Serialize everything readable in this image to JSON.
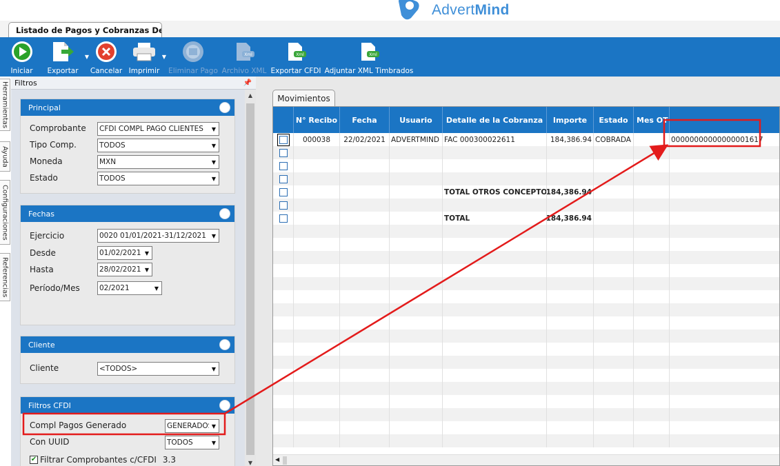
{
  "logo": {
    "text_light": "Advert",
    "text_bold": "Mind",
    "color": "#3f8fd8"
  },
  "document_tab": {
    "title": "Listado de Pagos y Cobranzas Det..."
  },
  "toolbar": {
    "buttons": [
      {
        "label": "Iniciar",
        "icon": "play-icon",
        "enabled": true
      },
      {
        "label": "Exportar",
        "icon": "export-icon",
        "enabled": true,
        "dropdown": true
      },
      {
        "label": "Cancelar",
        "icon": "cancel-icon",
        "enabled": true
      },
      {
        "label": "Imprimir",
        "icon": "printer-icon",
        "enabled": true,
        "dropdown": true
      },
      {
        "label": "Eliminar Pago",
        "icon": "delete-payment-icon",
        "enabled": false
      },
      {
        "label": "Archivo XML",
        "icon": "xml-file-icon",
        "enabled": false
      },
      {
        "label": "Exportar CFDI",
        "icon": "export-cfdi-icon",
        "enabled": true
      },
      {
        "label": "Adjuntar XML Timbrados",
        "icon": "attach-xml-icon",
        "enabled": true
      }
    ],
    "color": "#1b75c4"
  },
  "side_tabs": [
    "Herramientas",
    "Ayuda",
    "Configuraciones",
    "Referencias"
  ],
  "filtros": {
    "title": "Filtros",
    "principal": {
      "title": "Principal",
      "fields": [
        {
          "label": "Comprobante",
          "value": "CFDI COMPL PAGO CLIENTES"
        },
        {
          "label": "Tipo Comp.",
          "value": "TODOS"
        },
        {
          "label": "Moneda",
          "value": "MXN"
        },
        {
          "label": "Estado",
          "value": "TODOS"
        }
      ]
    },
    "fechas": {
      "title": "Fechas",
      "fields": [
        {
          "label": "Ejercicio",
          "value": "0020 01/01/2021-31/12/2021"
        },
        {
          "label": "Desde",
          "value": "01/02/2021"
        },
        {
          "label": "Hasta",
          "value": "28/02/2021"
        },
        {
          "label": "Período/Mes",
          "value": "02/2021"
        }
      ]
    },
    "cliente": {
      "title": "Cliente",
      "fields": [
        {
          "label": "Cliente",
          "value": "<TODOS>"
        }
      ]
    },
    "cfdi": {
      "title": "Filtros CFDI",
      "fields": [
        {
          "label": "Compl Pagos Generado",
          "value": "GENERADOS"
        },
        {
          "label": "Con UUID",
          "value": "TODOS"
        }
      ],
      "checkbox": {
        "label": "Filtrar Comprobantes c/CFDI",
        "version": "3.3",
        "checked": true
      }
    }
  },
  "movimientos": {
    "tab_label": "Movimientos",
    "columns": [
      "",
      "N° Recibo",
      "Fecha",
      "Usuario",
      "Detalle de la Cobranza",
      "Importe",
      "Estado",
      "Mes OT",
      ""
    ],
    "rows": [
      {
        "recibo": "000038",
        "fecha": "22/02/2021",
        "usuario": "ADVERTMIND",
        "detalle": "FAC 000300022611",
        "importe": "184,386.94",
        "estado": "COBRADA",
        "mes": "",
        "extra": "00000000000000001617",
        "focused": true
      },
      {
        "recibo": "",
        "fecha": "",
        "usuario": "",
        "detalle": "",
        "importe": "",
        "estado": "",
        "mes": "",
        "extra": ""
      },
      {
        "recibo": "",
        "fecha": "",
        "usuario": "",
        "detalle": "",
        "importe": "",
        "estado": "",
        "mes": "",
        "extra": ""
      },
      {
        "recibo": "",
        "fecha": "",
        "usuario": "",
        "detalle": "",
        "importe": "",
        "estado": "",
        "mes": "",
        "extra": ""
      },
      {
        "recibo": "",
        "fecha": "",
        "usuario": "",
        "detalle": "TOTAL OTROS CONCEPTOS",
        "importe": "184,386.94",
        "estado": "",
        "mes": "",
        "extra": "",
        "bold": true
      },
      {
        "recibo": "",
        "fecha": "",
        "usuario": "",
        "detalle": "",
        "importe": "",
        "estado": "",
        "mes": "",
        "extra": ""
      },
      {
        "recibo": "",
        "fecha": "",
        "usuario": "",
        "detalle": "TOTAL",
        "importe": "184,386.94",
        "estado": "",
        "mes": "",
        "extra": "",
        "bold": true
      }
    ]
  },
  "annotation": {
    "color": "#e31b1b"
  }
}
